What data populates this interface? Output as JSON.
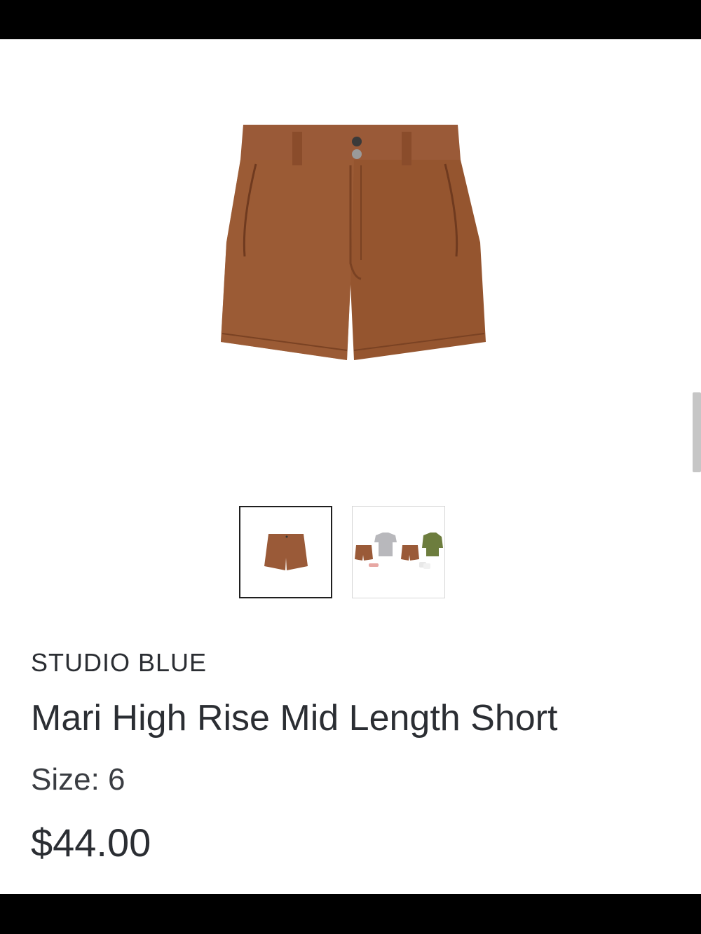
{
  "product": {
    "brand": "STUDIO BLUE",
    "name": "Mari High Rise Mid Length Short",
    "size_label": "Size: 6",
    "price": "$44.00"
  },
  "gallery": {
    "images": [
      {
        "name": "main-shorts-image",
        "selected": true
      },
      {
        "name": "styled-outfits-image",
        "selected": false
      }
    ]
  },
  "colors": {
    "shorts": "#9a5a38",
    "text": "#2b2e33",
    "bars": "#000000"
  }
}
